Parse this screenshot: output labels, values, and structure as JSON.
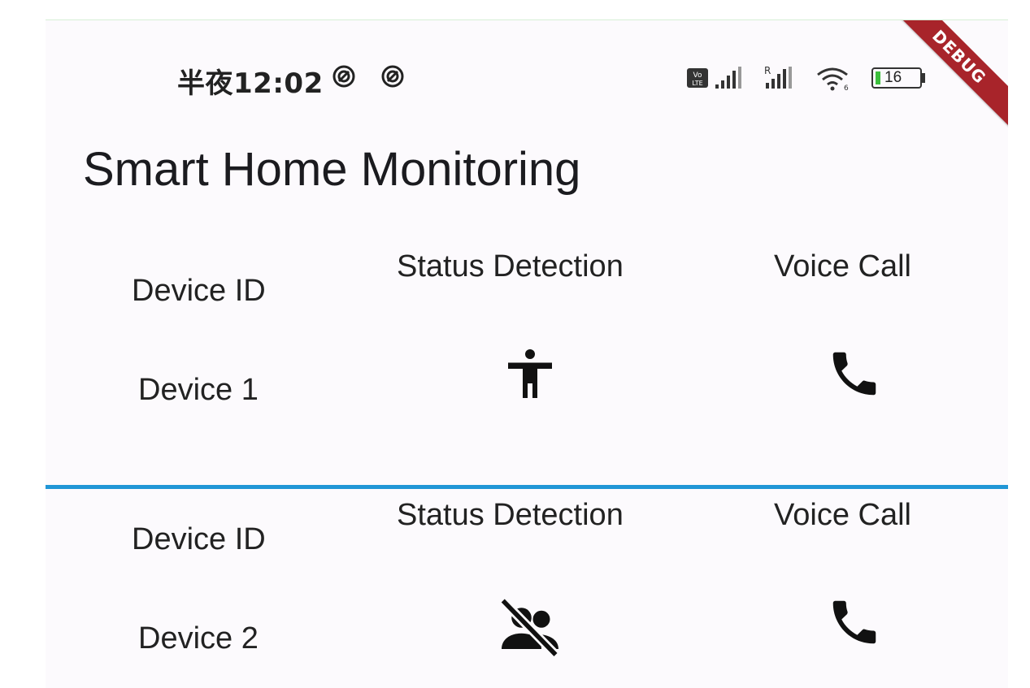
{
  "status_bar": {
    "time": "半夜12:02",
    "notification_icons": [
      "sync-icon",
      "sync-icon"
    ],
    "system_icons": [
      "volte-icon",
      "signal-icon",
      "roaming-signal-icon",
      "wifi-icon",
      "battery-icon"
    ],
    "battery_percent": "16",
    "debug_label": "DEBUG"
  },
  "app": {
    "title": "Smart Home Monitoring"
  },
  "devices": [
    {
      "header_device_id": "Device ID",
      "header_status": "Status Detection",
      "header_voice": "Voice Call",
      "device_name": "Device 1",
      "status_icon": "person-icon",
      "voice_icon": "phone-icon"
    },
    {
      "header_device_id": "Device ID",
      "header_status": "Status Detection",
      "header_voice": "Voice Call",
      "device_name": "Device 2",
      "status_icon": "people-off-icon",
      "voice_icon": "phone-icon"
    }
  ],
  "colors": {
    "background": "#fcfafd",
    "divider": "#2196d6",
    "debug_banner": "#a8242a",
    "text": "#222222"
  }
}
